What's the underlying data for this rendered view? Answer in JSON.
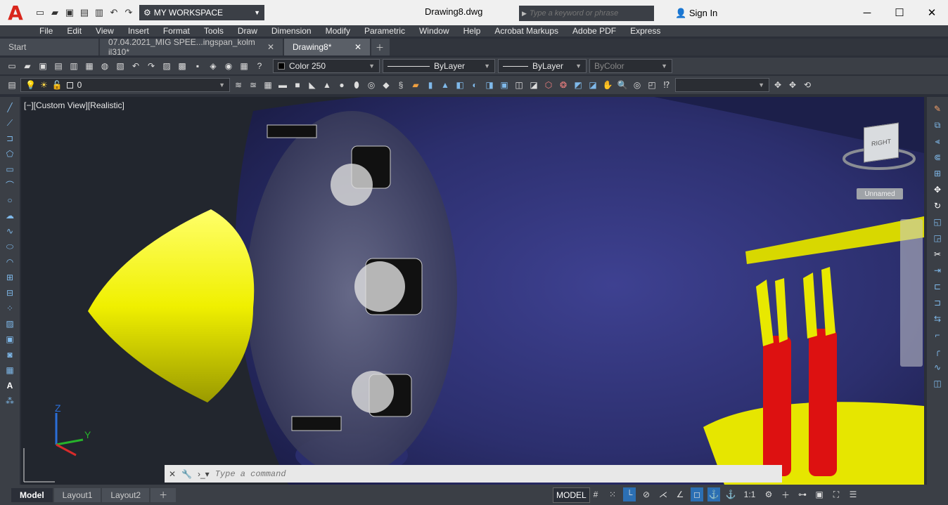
{
  "app": {
    "doc_title": "Drawing8.dwg"
  },
  "workspace": "MY WORKSPACE",
  "search_placeholder": "Type a keyword or phrase",
  "signin": "Sign In",
  "menu": [
    "File",
    "Edit",
    "View",
    "Insert",
    "Format",
    "Tools",
    "Draw",
    "Dimension",
    "Modify",
    "Parametric",
    "Window",
    "Help",
    "Acrobat Markups",
    "Adobe PDF",
    "Express"
  ],
  "tabs": [
    "Start",
    "07.04.2021_MIG SPEE...ingspan_kolm il310*",
    "Drawing8*"
  ],
  "color_combo": "Color 250",
  "linetype_combo": "ByLayer",
  "lineweight_combo": "ByLayer",
  "plotstyle_combo": "ByColor",
  "layer_combo": "0",
  "viewport_label": "[−][Custom View][Realistic]",
  "ucs_unnamed": "Unnamed",
  "viewcube_face": "RIGHT",
  "command_placeholder": "Type a command",
  "layout_tabs": [
    "Model",
    "Layout1",
    "Layout2"
  ],
  "status_model": "MODEL",
  "scale": "1:1",
  "ucs_axes": {
    "x": "X",
    "y": "Y",
    "z": "Z"
  }
}
